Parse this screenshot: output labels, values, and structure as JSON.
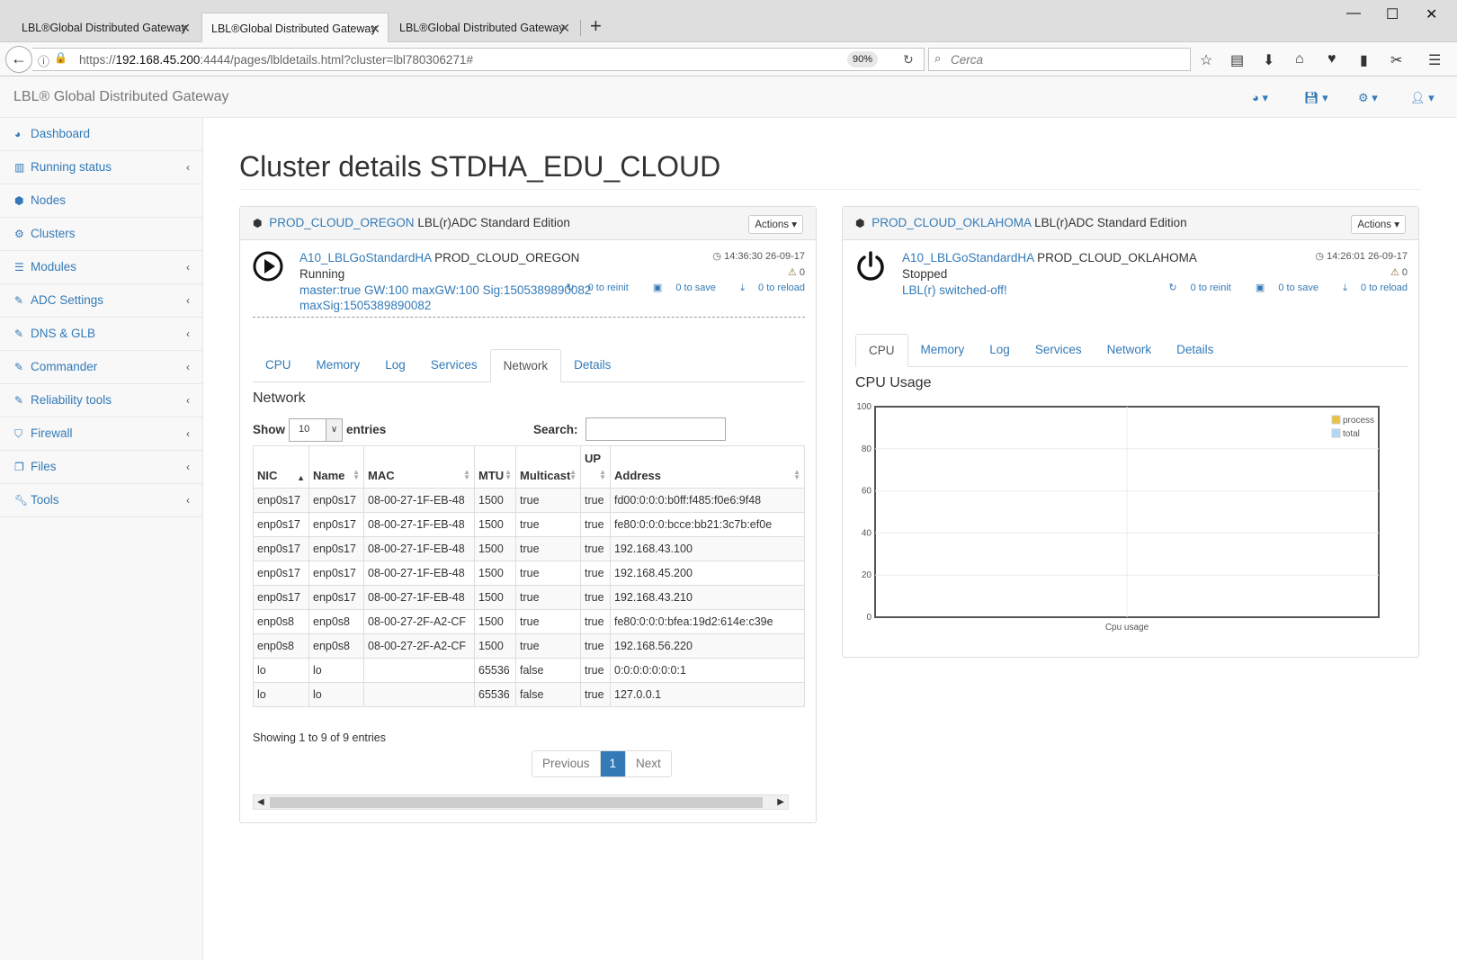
{
  "browser": {
    "tabs": [
      {
        "label": "LBL®Global Distributed Gateway"
      },
      {
        "label": "LBL®Global Distributed Gateway"
      },
      {
        "label": "LBL®Global Distributed Gateway"
      }
    ],
    "url_prefix": "https://",
    "url_host": "192.168.45.200",
    "url_rest": ":4444/pages/lbldetails.html?cluster=lbl780306271#",
    "zoom": "90%",
    "search_placeholder": "Cerca"
  },
  "app": {
    "brand": "LBL® Global Distributed Gateway"
  },
  "sidebar": {
    "items": [
      {
        "label": "Dashboard",
        "icon": "dashboard-icon"
      },
      {
        "label": "Running status",
        "icon": "bar-chart-icon"
      },
      {
        "label": "Nodes",
        "icon": "cube-icon"
      },
      {
        "label": "Clusters",
        "icon": "cogs-icon"
      },
      {
        "label": "Modules",
        "icon": "list-icon"
      },
      {
        "label": "ADC Settings",
        "icon": "edit-icon"
      },
      {
        "label": "DNS & GLB",
        "icon": "edit-icon"
      },
      {
        "label": "Commander",
        "icon": "edit-icon"
      },
      {
        "label": "Reliability tools",
        "icon": "edit-icon"
      },
      {
        "label": "Firewall",
        "icon": "shield-icon"
      },
      {
        "label": "Files",
        "icon": "files-icon"
      },
      {
        "label": "Tools",
        "icon": "wrench-icon"
      }
    ]
  },
  "page": {
    "title": "Cluster details STDHA_EDU_CLOUD"
  },
  "left": {
    "node_link": "PROD_CLOUD_OREGON",
    "edition": "LBL(r)ADC Standard Edition",
    "actions": "Actions",
    "module": "A10_LBLGoStandardHA",
    "node": "PROD_CLOUD_OREGON",
    "status": "Running",
    "extra1": "master:true GW:100 maxGW:100 Sig:1505389890082",
    "extra2": "maxSig:1505389890082",
    "time": "14:36:30 26-09-17",
    "warnings": "0",
    "reinit": "0 to reinit",
    "save": "0 to save",
    "reload": "0 to reload",
    "tabs": [
      "CPU",
      "Memory",
      "Log",
      "Services",
      "Network",
      "Details"
    ],
    "section": "Network",
    "show": "Show",
    "entries_value": "10",
    "entries": "entries",
    "search": "Search:",
    "columns": [
      "NIC",
      "Name",
      "MAC",
      "MTU",
      "Multicast",
      "UP",
      "Address"
    ],
    "rows": [
      [
        "enp0s17",
        "enp0s17",
        "08-00-27-1F-EB-48",
        "1500",
        "true",
        "true",
        "fd00:0:0:0:b0ff:f485:f0e6:9f48"
      ],
      [
        "enp0s17",
        "enp0s17",
        "08-00-27-1F-EB-48",
        "1500",
        "true",
        "true",
        "fe80:0:0:0:bcce:bb21:3c7b:ef0e"
      ],
      [
        "enp0s17",
        "enp0s17",
        "08-00-27-1F-EB-48",
        "1500",
        "true",
        "true",
        "192.168.43.100"
      ],
      [
        "enp0s17",
        "enp0s17",
        "08-00-27-1F-EB-48",
        "1500",
        "true",
        "true",
        "192.168.45.200"
      ],
      [
        "enp0s17",
        "enp0s17",
        "08-00-27-1F-EB-48",
        "1500",
        "true",
        "true",
        "192.168.43.210"
      ],
      [
        "enp0s8",
        "enp0s8",
        "08-00-27-2F-A2-CF",
        "1500",
        "true",
        "true",
        "fe80:0:0:0:bfea:19d2:614e:c39e"
      ],
      [
        "enp0s8",
        "enp0s8",
        "08-00-27-2F-A2-CF",
        "1500",
        "true",
        "true",
        "192.168.56.220"
      ],
      [
        "lo",
        "lo",
        "",
        "65536",
        "false",
        "true",
        "0:0:0:0:0:0:0:1"
      ],
      [
        "lo",
        "lo",
        "",
        "65536",
        "false",
        "true",
        "127.0.0.1"
      ]
    ],
    "showing": "Showing 1 to 9 of 9 entries",
    "prev": "Previous",
    "page": "1",
    "next": "Next"
  },
  "right": {
    "node_link": "PROD_CLOUD_OKLAHOMA",
    "edition": "LBL(r)ADC Standard Edition",
    "actions": "Actions",
    "module": "A10_LBLGoStandardHA",
    "node": "PROD_CLOUD_OKLAHOMA",
    "status": "Stopped",
    "extra1": "LBL(r) switched-off!",
    "time": "14:26:01 26-09-17",
    "warnings": "0",
    "reinit": "0 to reinit",
    "save": "0 to save",
    "reload": "0 to reload",
    "tabs": [
      "CPU",
      "Memory",
      "Log",
      "Services",
      "Network",
      "Details"
    ],
    "section": "CPU Usage"
  },
  "chart_data": {
    "type": "line",
    "title": "",
    "xlabel": "Cpu usage",
    "ylabel": "",
    "ylim": [
      0,
      100
    ],
    "yticks": [
      "100",
      "80",
      "60",
      "40",
      "20",
      "0"
    ],
    "grid": true,
    "legend_position": "top-right",
    "series": [
      {
        "name": "process",
        "color": "#edc240",
        "values": []
      },
      {
        "name": "total",
        "color": "#afd8f8",
        "values": []
      }
    ]
  }
}
